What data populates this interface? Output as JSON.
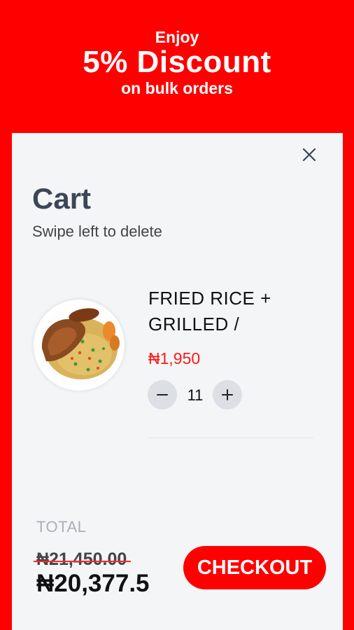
{
  "promo": {
    "line1": "Enjoy",
    "line2": "5% Discount",
    "line3": "on bulk orders"
  },
  "cart": {
    "title": "Cart",
    "subtitle": "Swipe left to delete",
    "close_icon": "close-icon"
  },
  "item": {
    "name": "FRIED RICE + GRILLED /",
    "price": "₦1,950",
    "quantity": "11",
    "image": "fried-rice-with-chicken-image"
  },
  "summary": {
    "total_label": "TOTAL",
    "original_total": "₦21,450.00",
    "discounted_total": "₦20,377.5",
    "checkout_label": "CHECKOUT"
  },
  "colors": {
    "brand_red": "#ff0000",
    "panel_bg": "#f3f5f7",
    "price_red": "#ff1a1a"
  }
}
